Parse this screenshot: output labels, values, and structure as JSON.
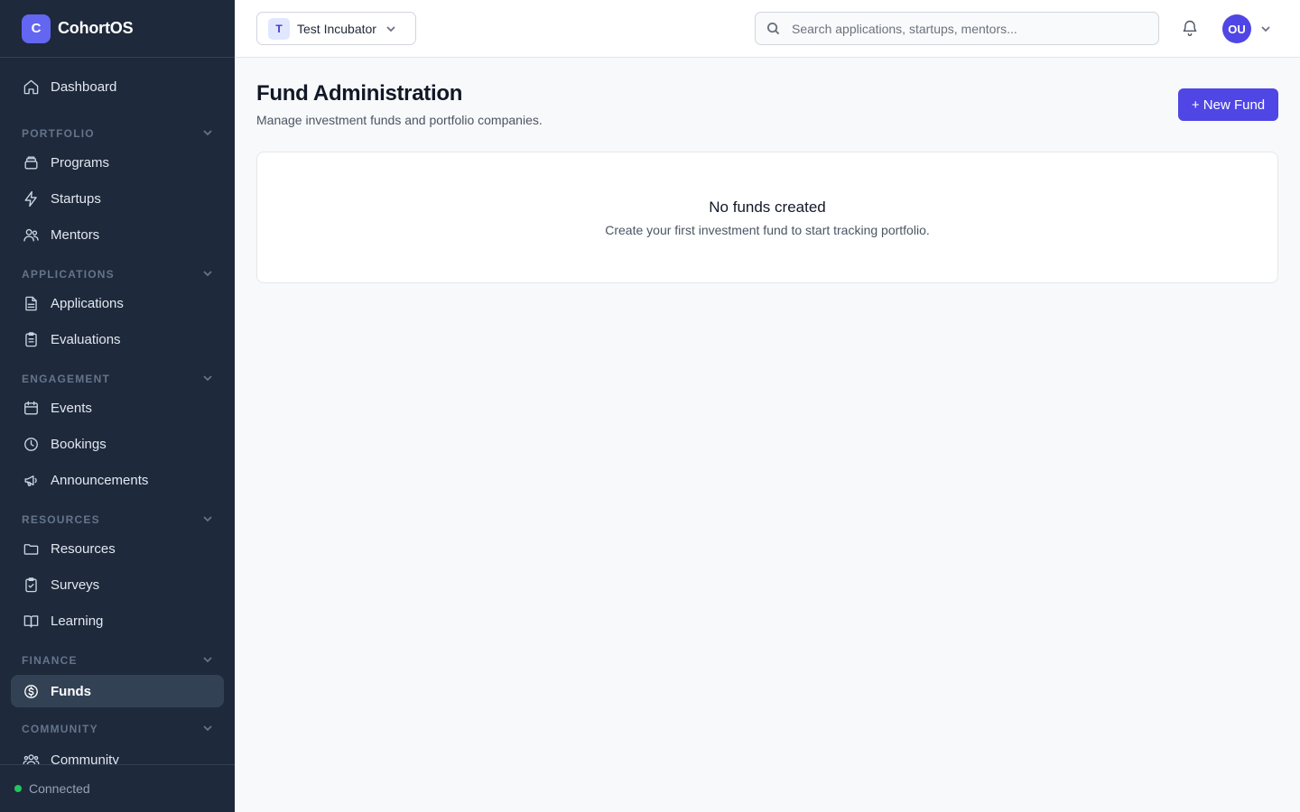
{
  "brand": {
    "logo_letter": "C",
    "name": "CohortOS"
  },
  "sidebar": {
    "dashboard": "Dashboard",
    "sections": {
      "portfolio": "PORTFOLIO",
      "applications": "APPLICATIONS",
      "engagement": "ENGAGEMENT",
      "resources": "RESOURCES",
      "finance": "FINANCE",
      "community": "COMMUNITY"
    },
    "items": {
      "programs": "Programs",
      "startups": "Startups",
      "mentors": "Mentors",
      "applications": "Applications",
      "evaluations": "Evaluations",
      "events": "Events",
      "bookings": "Bookings",
      "announcements": "Announcements",
      "resources": "Resources",
      "surveys": "Surveys",
      "learning": "Learning",
      "funds": "Funds",
      "community": "Community"
    },
    "active_item": "Funds",
    "status": "Connected"
  },
  "topbar": {
    "org": {
      "initial": "T",
      "name": "Test Incubator"
    },
    "search_placeholder": "Search applications, startups, mentors...",
    "user_initials": "OU"
  },
  "main": {
    "title": "Fund Administration",
    "subtitle": "Manage investment funds and portfolio companies.",
    "new_button": "+ New Fund",
    "empty_state": {
      "title": "No funds created",
      "description": "Create your first investment fund to start tracking portfolio."
    }
  },
  "colors": {
    "sidebar_bg": "#1e293b",
    "accent": "#4f46e5",
    "status_connected": "#22c55e"
  }
}
